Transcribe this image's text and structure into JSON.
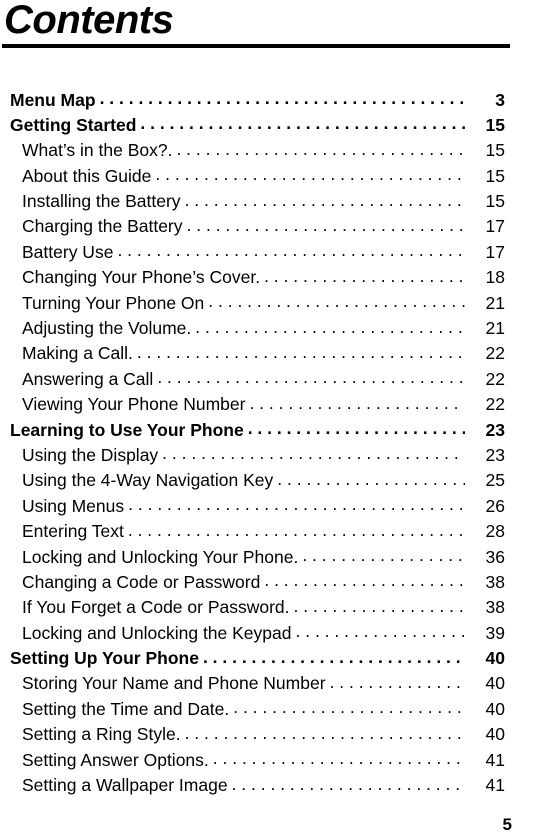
{
  "document": {
    "title": "Contents",
    "footer_page_number": "5"
  },
  "entries": [
    {
      "label": "Menu Map",
      "page": "3",
      "level": 1
    },
    {
      "label": "Getting Started",
      "page": "15",
      "level": 1
    },
    {
      "label": "What’s in the Box?.",
      "page": "15",
      "level": 2
    },
    {
      "label": "About this Guide",
      "page": "15",
      "level": 2
    },
    {
      "label": "Installing the Battery",
      "page": "15",
      "level": 2
    },
    {
      "label": "Charging the Battery",
      "page": "17",
      "level": 2
    },
    {
      "label": "Battery Use",
      "page": "17",
      "level": 2
    },
    {
      "label": "Changing Your Phone’s Cover.",
      "page": "18",
      "level": 2
    },
    {
      "label": "Turning Your Phone On",
      "page": "21",
      "level": 2
    },
    {
      "label": "Adjusting the Volume.",
      "page": "21",
      "level": 2
    },
    {
      "label": "Making a Call.",
      "page": "22",
      "level": 2
    },
    {
      "label": "Answering a Call",
      "page": "22",
      "level": 2
    },
    {
      "label": "Viewing Your Phone Number",
      "page": "22",
      "level": 2
    },
    {
      "label": "Learning to Use Your Phone",
      "page": "23",
      "level": 1
    },
    {
      "label": "Using the Display",
      "page": "23",
      "level": 2
    },
    {
      "label": "Using the 4-Way Navigation Key",
      "page": "25",
      "level": 2
    },
    {
      "label": "Using Menus",
      "page": "26",
      "level": 2
    },
    {
      "label": "Entering Text",
      "page": "28",
      "level": 2
    },
    {
      "label": "Locking and Unlocking Your Phone.",
      "page": "36",
      "level": 2
    },
    {
      "label": "Changing a Code or Password",
      "page": "38",
      "level": 2
    },
    {
      "label": "If You Forget a Code or Password.",
      "page": "38",
      "level": 2
    },
    {
      "label": "Locking and Unlocking the Keypad",
      "page": "39",
      "level": 2
    },
    {
      "label": "Setting Up Your Phone",
      "page": "40",
      "level": 1
    },
    {
      "label": "Storing Your Name and Phone Number",
      "page": "40",
      "level": 2
    },
    {
      "label": "Setting the Time and Date.",
      "page": "40",
      "level": 2
    },
    {
      "label": "Setting a Ring Style.",
      "page": "40",
      "level": 2
    },
    {
      "label": "Setting Answer Options.",
      "page": "41",
      "level": 2
    },
    {
      "label": "Setting a Wallpaper Image",
      "page": "41",
      "level": 2
    }
  ]
}
